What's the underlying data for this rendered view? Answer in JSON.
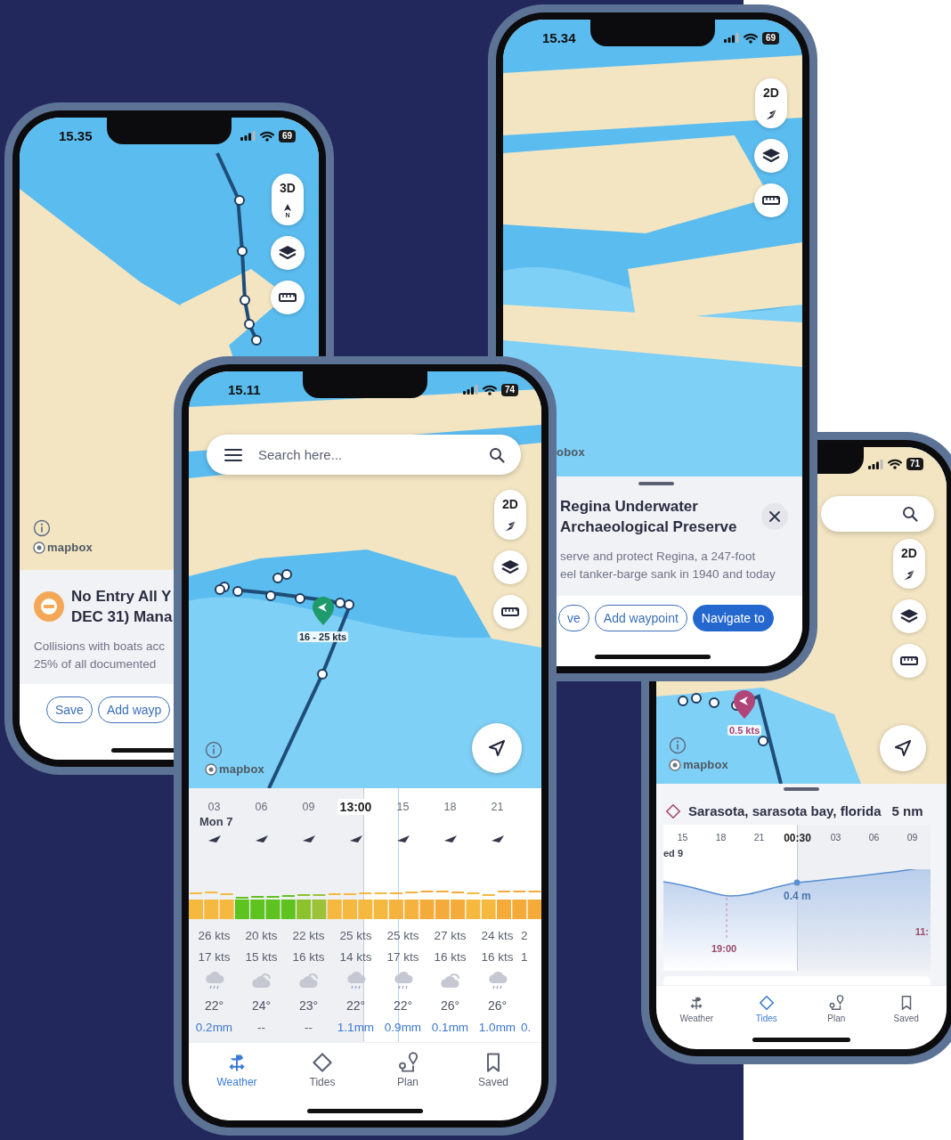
{
  "back_left_phone": {
    "status": {
      "time": "15.35",
      "battery": "69"
    },
    "map": {
      "view_toggle": "3D",
      "north_label": "N",
      "attribution": "mapbox"
    },
    "sheet": {
      "title_lines": [
        "No Entry All Y",
        "DEC 31) Mana"
      ],
      "body_lines": [
        "Collisions with boats acc",
        "25% of all documented"
      ],
      "buttons": [
        {
          "label": "Save",
          "primary": false
        },
        {
          "label": "Add wayp",
          "primary": false
        }
      ]
    }
  },
  "top_right_phone": {
    "status": {
      "time": "15.34",
      "battery": "69"
    },
    "map": {
      "view_toggle": "2D",
      "attribution": "obox"
    },
    "sheet": {
      "title_lines": [
        "Regina Underwater",
        "Archaeological Preserve"
      ],
      "body_lines": [
        "serve and protect Regina, a 247-foot",
        "eel tanker-barge sank in 1940 and today"
      ],
      "buttons": [
        {
          "label": "ve",
          "primary": false
        },
        {
          "label": "Add waypoint",
          "primary": false
        },
        {
          "label": "Navigate to",
          "primary": true
        }
      ]
    }
  },
  "front_right_phone": {
    "status": {
      "battery": "71"
    },
    "map": {
      "view_toggle": "2D",
      "attribution": "mapbox",
      "marker_label": "0.5 kts"
    },
    "tide": {
      "location": "Sarasota, sarasota bay, florida",
      "distance": "5 nm",
      "hours": [
        {
          "label": "15",
          "selected": false
        },
        {
          "label": "18",
          "selected": false
        },
        {
          "label": "21",
          "selected": false
        },
        {
          "label": "00:30",
          "selected": true
        },
        {
          "label": "03",
          "selected": false
        },
        {
          "label": "06",
          "selected": false
        },
        {
          "label": "09",
          "selected": false
        }
      ],
      "day": "ed 9",
      "reading": "0.4 m",
      "low_time": "19:00",
      "next_time": "11:"
    },
    "tabs": [
      {
        "label": "Weather",
        "selected": false
      },
      {
        "label": "Tides",
        "selected": true
      },
      {
        "label": "Plan",
        "selected": false
      },
      {
        "label": "Saved",
        "selected": false
      }
    ]
  },
  "center_phone": {
    "status": {
      "time": "15.11",
      "battery": "74"
    },
    "search": {
      "placeholder": "Search here..."
    },
    "map": {
      "view_toggle": "2D",
      "attribution": "mapbox",
      "marker_label": "16 - 25 kts"
    },
    "forecast": {
      "hours": [
        {
          "label": "03",
          "selected": false
        },
        {
          "label": "06",
          "selected": false
        },
        {
          "label": "09",
          "selected": false
        },
        {
          "label": "13:00",
          "selected": true
        },
        {
          "label": "15",
          "selected": false
        },
        {
          "label": "18",
          "selected": false
        },
        {
          "label": "21",
          "selected": false
        }
      ],
      "day": "Mon 7",
      "columns": [
        {
          "gust": "26 kts",
          "wind": "17 kts",
          "kind": "rain",
          "temp": "22°",
          "precip": "0.2mm",
          "dry": false
        },
        {
          "gust": "20 kts",
          "wind": "15 kts",
          "kind": "cloudy",
          "temp": "24°",
          "precip": "--",
          "dry": true
        },
        {
          "gust": "22 kts",
          "wind": "16 kts",
          "kind": "cloudy",
          "temp": "23°",
          "precip": "--",
          "dry": true
        },
        {
          "gust": "25 kts",
          "wind": "14 kts",
          "kind": "rain",
          "temp": "22°",
          "precip": "1.1mm",
          "dry": false
        },
        {
          "gust": "25 kts",
          "wind": "17 kts",
          "kind": "rain",
          "temp": "22°",
          "precip": "0.9mm",
          "dry": false
        },
        {
          "gust": "27 kts",
          "wind": "16 kts",
          "kind": "cloudy",
          "temp": "26°",
          "precip": "0.1mm",
          "dry": false
        },
        {
          "gust": "24 kts",
          "wind": "16 kts",
          "kind": "rain",
          "temp": "26°",
          "precip": "1.0mm",
          "dry": false
        },
        {
          "gust": "2",
          "wind": "1",
          "precip": "0.",
          "dry": false
        }
      ]
    },
    "tabs": [
      {
        "label": "Weather",
        "selected": true
      },
      {
        "label": "Tides",
        "selected": false
      },
      {
        "label": "Plan",
        "selected": false
      },
      {
        "label": "Saved",
        "selected": false
      }
    ]
  }
}
